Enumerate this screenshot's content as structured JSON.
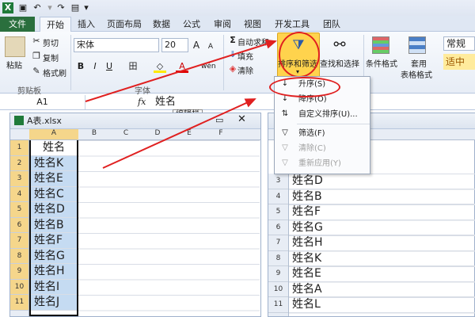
{
  "quick_access": {
    "excel_icon": "excel-icon",
    "save_icon": "save-icon",
    "undo_icon": "undo-icon",
    "redo_icon": "redo-icon",
    "format_icon": "format-painter-icon"
  },
  "tabs": [
    "文件",
    "开始",
    "插入",
    "页面布局",
    "数据",
    "公式",
    "审阅",
    "视图",
    "开发工具",
    "团队"
  ],
  "ribbon": {
    "clipboard": {
      "paste": "粘贴",
      "cut": "剪切",
      "copy": "复制",
      "format_painter": "格式刷",
      "group": "剪贴板"
    },
    "font": {
      "name": "宋体",
      "size": "20",
      "bold": "B",
      "italic": "I",
      "underline": "U",
      "font_color": "A",
      "wen": "wén",
      "grow": "A",
      "shrink": "A",
      "group": "字体"
    },
    "editing": {
      "autosum": "自动求和",
      "fill": "填充",
      "clear": "清除",
      "sort_filter": "排序和筛选",
      "find_select": "查找和选择"
    },
    "styles": {
      "cond_format": "条件格式",
      "table_format_1": "套用",
      "table_format_2": "表格格式",
      "number_format": "常规",
      "cell_style": "适中"
    }
  },
  "formula_bar": {
    "name_box": "A1",
    "fx": "fx",
    "value": "姓名"
  },
  "tooltip": "编辑栏",
  "menu": {
    "items": [
      {
        "label": "升序(S)",
        "icon": "sort-ascending-icon",
        "disabled": false
      },
      {
        "label": "降序(O)",
        "icon": "sort-descending-icon",
        "disabled": false
      },
      {
        "label": "自定义排序(U)...",
        "icon": "custom-sort-icon",
        "disabled": false
      },
      {
        "label": "筛选(F)",
        "icon": "filter-icon",
        "disabled": false
      },
      {
        "label": "清除(C)",
        "icon": "clear-filter-icon",
        "disabled": true
      },
      {
        "label": "重新应用(Y)",
        "icon": "reapply-icon",
        "disabled": true
      }
    ]
  },
  "left_window": {
    "title": "A表.xlsx",
    "columns": [
      "A",
      "B",
      "C",
      "D",
      "E",
      "F"
    ],
    "rows": [
      "1",
      "2",
      "3",
      "4",
      "5",
      "6",
      "7",
      "8",
      "9",
      "10",
      "11"
    ],
    "cells": [
      "姓名",
      "姓名K",
      "姓名E",
      "姓名C",
      "姓名D",
      "姓名B",
      "姓名F",
      "姓名G",
      "姓名H",
      "姓名I",
      "姓名J"
    ]
  },
  "right_window": {
    "rows": [
      "3",
      "4",
      "5",
      "6",
      "7",
      "8",
      "9",
      "10",
      "11"
    ],
    "cells": [
      "姓名D",
      "姓名B",
      "姓名F",
      "姓名G",
      "姓名H",
      "姓名K",
      "姓名E",
      "姓名A",
      "姓名L"
    ]
  },
  "colors": {
    "accent": "#e02020",
    "file_tab": "#2a6f3d",
    "selection": "#c5dbf2",
    "highlight": "#ffd34d"
  }
}
